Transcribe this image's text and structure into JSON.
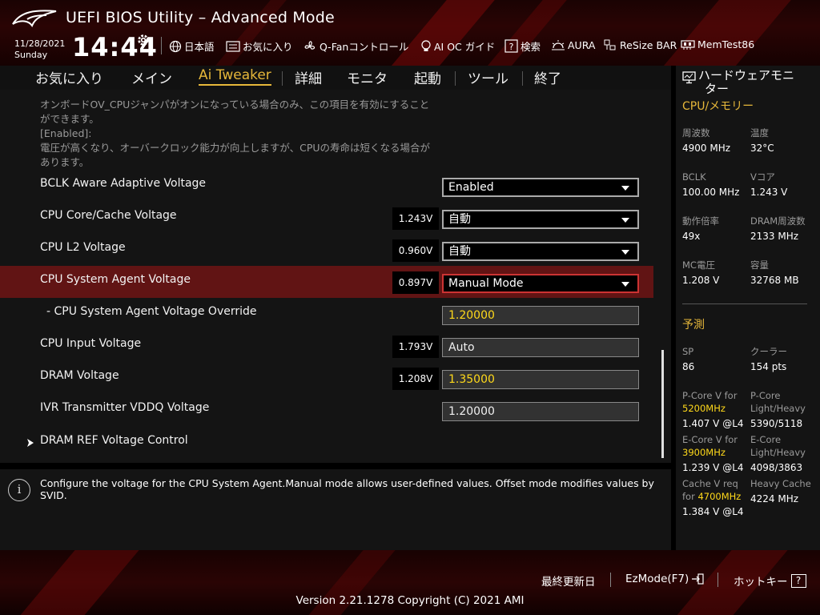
{
  "header": {
    "title": "UEFI BIOS Utility – Advanced Mode",
    "date": "11/28/2021",
    "day": "Sunday",
    "time": "14:44",
    "tools": [
      "日本語",
      "お気に入り",
      "Q-Fanコントロール",
      "AI OC ガイド",
      "検索",
      "AURA",
      "ReSize BAR",
      "MemTest86"
    ]
  },
  "menu": {
    "items": [
      "お気に入り",
      "メイン",
      "Ai Tweaker",
      "詳細",
      "モニタ",
      "起動",
      "ツール",
      "終了"
    ],
    "active": "Ai Tweaker"
  },
  "description": {
    "lines": [
      "オンボードOV_CPUジャンパがオンになっている場合のみ、この項目を有効にすること",
      "ができます。",
      "[Enabled]:",
      "電圧が高くなり、オーバークロック能力が向上しますが、CPUの寿命は短くなる場合が",
      "あります。"
    ]
  },
  "settings": [
    {
      "label": "BCLK Aware Adaptive Voltage",
      "voltage": "",
      "value": "Enabled",
      "control": "dropdown"
    },
    {
      "label": "CPU Core/Cache Voltage",
      "voltage": "1.243V",
      "value": "自動",
      "control": "dropdown"
    },
    {
      "label": "CPU L2 Voltage",
      "voltage": "0.960V",
      "value": "自動",
      "control": "dropdown"
    },
    {
      "label": "CPU System Agent Voltage",
      "voltage": "0.897V",
      "value": "Manual Mode",
      "control": "dropdown",
      "selected": true
    },
    {
      "label": "- CPU System Agent Voltage Override",
      "voltage": "",
      "value": "1.20000",
      "control": "field",
      "highlight": true
    },
    {
      "label": "CPU Input Voltage",
      "voltage": "1.793V",
      "value": "Auto",
      "control": "field"
    },
    {
      "label": "DRAM Voltage",
      "voltage": "1.208V",
      "value": "1.35000",
      "control": "field",
      "highlight": true
    },
    {
      "label": "IVR Transmitter VDDQ Voltage",
      "voltage": "",
      "value": "1.20000",
      "control": "field"
    },
    {
      "label": "DRAM REF Voltage Control",
      "voltage": "",
      "value": "",
      "control": "submenu"
    }
  ],
  "info": {
    "text": "Configure the voltage for the CPU System Agent.Manual mode allows user-defined values. Offset mode modifies values by SVID."
  },
  "hw_monitor": {
    "title_line1": "ハードウェアモニ",
    "title_line2": "ター",
    "cpu_section": "CPU/メモリー",
    "cpu_items": [
      {
        "label": "周波数",
        "value": "4900 MHz"
      },
      {
        "label": "温度",
        "value": "32°C"
      },
      {
        "label": "BCLK",
        "value": "100.00 MHz"
      },
      {
        "label": "Vコア",
        "value": "1.243 V"
      },
      {
        "label": "動作倍率",
        "value": "49x"
      },
      {
        "label": "DRAM周波数",
        "value": "2133 MHz"
      },
      {
        "label": "MC電圧",
        "value": "1.208 V"
      },
      {
        "label": "容量",
        "value": "32768 MB"
      }
    ],
    "predict_section": "予測",
    "sp_label": "SP",
    "sp_value": "86",
    "cooler_label": "クーラー",
    "cooler_value": "154 pts",
    "pcore_label": "P-Core V for",
    "pcore_freq": "5200MHz",
    "pcore_value": "1.407 V @L4",
    "pcore_lh_label1": "P-Core",
    "pcore_lh_label2": "Light/Heavy",
    "pcore_lh_value": "5390/5118",
    "ecore_label": "E-Core V for",
    "ecore_freq": "3900MHz",
    "ecore_value": "1.239 V @L4",
    "ecore_lh_label1": "E-Core",
    "ecore_lh_label2": "Light/Heavy",
    "ecore_lh_value": "4098/3863",
    "cache_label1": "Cache V req",
    "cache_label2": "for",
    "cache_freq": "4700MHz",
    "cache_value": "1.384 V @L4",
    "heavy_cache_label": "Heavy Cache",
    "heavy_cache_value": "4224 MHz"
  },
  "footer": {
    "last_modified": "最終更新日",
    "ezmode": "EzMode(F7)",
    "hotkey": "ホットキー",
    "hotkey_glyph": "?",
    "version": "Version 2.21.1278 Copyright (C) 2021 AMI"
  },
  "colors": {
    "accent": "#e6b73a",
    "selected_row": "#611414",
    "highlight_value": "#ffd91a"
  }
}
